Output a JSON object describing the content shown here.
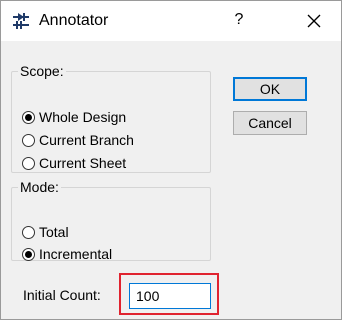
{
  "window": {
    "title": "Annotator",
    "help_glyph": "?",
    "app_icon": "annotator-app-icon",
    "close_icon": "close-icon"
  },
  "scope": {
    "label": "Scope:",
    "options": [
      {
        "label": "Whole Design",
        "selected": true
      },
      {
        "label": "Current Branch",
        "selected": false
      },
      {
        "label": "Current Sheet",
        "selected": false
      }
    ]
  },
  "mode": {
    "label": "Mode:",
    "options": [
      {
        "label": "Total",
        "selected": false
      },
      {
        "label": "Incremental",
        "selected": true
      }
    ]
  },
  "buttons": {
    "ok": "OK",
    "cancel": "Cancel"
  },
  "initial_count": {
    "label": "Initial Count:",
    "value": "100"
  },
  "colors": {
    "focus_border": "#0078d7",
    "highlight_border": "#e0232f"
  }
}
